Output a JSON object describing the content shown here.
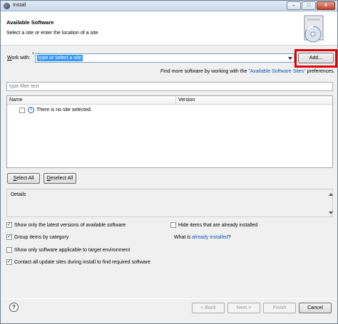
{
  "window": {
    "title": "Install",
    "minimize_glyph": "–",
    "maximize_glyph": "□",
    "close_glyph": "x"
  },
  "header": {
    "title": "Available Software",
    "description": "Select a site or enter the location of a site."
  },
  "work_with": {
    "label_pre": "",
    "label_mnemonic": "W",
    "label_post": "ork with:",
    "combo_value": "type or select a site",
    "add_button_label": "Add..."
  },
  "more_software": {
    "text_pre": "Find more software by working with the ",
    "link": "\"Available Software Sites\"",
    "text_post": " preferences."
  },
  "filter": {
    "placeholder": "type filter text"
  },
  "table": {
    "columns": [
      "Name",
      "Version"
    ],
    "rows": [
      {
        "name": "There is no site selected.",
        "icon": "info-icon"
      }
    ]
  },
  "buttons": {
    "select_all": "Select All",
    "deselect_all": "Deselect All",
    "back": "< Back",
    "next": "Next >",
    "finish": "Finish",
    "cancel": "Cancel"
  },
  "details": {
    "label": "Details"
  },
  "options": {
    "latest_versions": {
      "label": "Show only the latest versions of available software",
      "checked": true
    },
    "group_by_category": {
      "label": "Group items by category",
      "checked": true
    },
    "applicable_only": {
      "label": "Show only software applicable to target environment",
      "checked": false
    },
    "contact_sites": {
      "label": "Contact all update sites during install to find required software",
      "checked": true
    },
    "hide_installed": {
      "label": "Hide items that are already installed",
      "checked": false
    },
    "what_is_pre": "What is ",
    "already_installed_link": "already installed",
    "what_is_post": "?"
  },
  "colors": {
    "accent": "#3399ff",
    "link": "#0c59b5",
    "highlight": "#e00000"
  }
}
